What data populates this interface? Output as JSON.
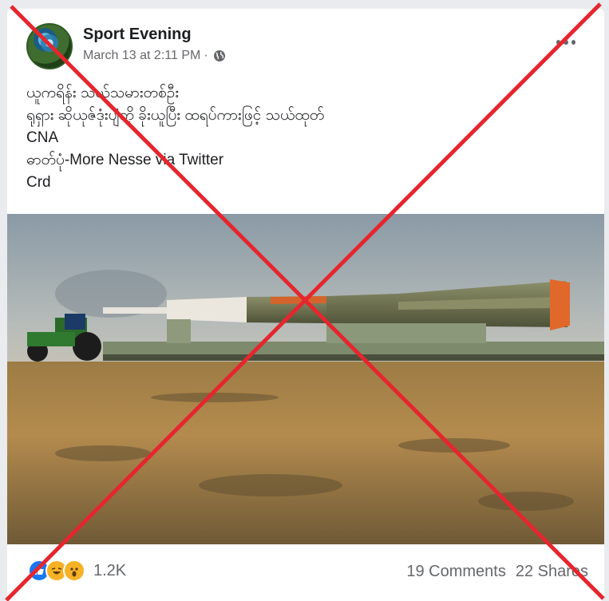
{
  "post": {
    "page_name": "Sport Evening",
    "date": "March 13 at 2:11 PM",
    "separator": "·",
    "caption_lines": [
      "ယူကရိန်း သယ်သမားတစ်ဦး",
      "ရုရှား ဆိုယုဇ်ဒုံးပျံကို ခိုးယူပြီး ထရပ်ကားဖြင့် သယ်ထုတ်",
      "CNA",
      "ဓာတ်ပုံ-More Nesse via Twitter",
      "Crd"
    ],
    "reaction_count": "1.2K",
    "comments": "19 Comments",
    "shares": "22 Shares"
  },
  "icons": {
    "globe": "globe-icon",
    "more": "more-options-icon",
    "reactions": [
      "like-icon",
      "haha-icon",
      "wow-icon"
    ]
  },
  "colors": {
    "overlay_cross": "#e5262e",
    "like": "#1877f2",
    "emoji": "#f7b125"
  }
}
